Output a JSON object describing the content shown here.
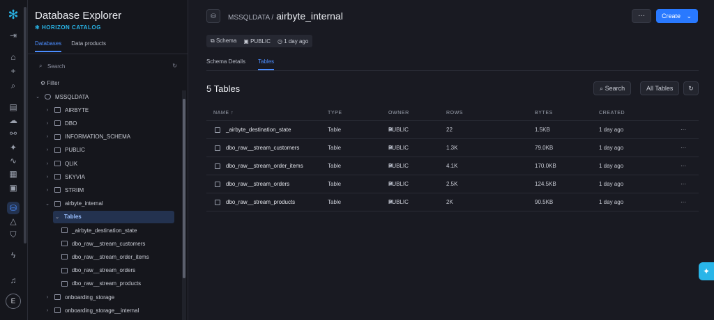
{
  "rail": {
    "logo_icon": "snowflake-icon",
    "collapse_icon": "collapse-icon",
    "avatar_initial": "E"
  },
  "sidebar": {
    "title": "Database Explorer",
    "subtitle": "HORIZON CATALOG",
    "tabs": [
      "Databases",
      "Data products"
    ],
    "search_placeholder": "Search",
    "filter_label": "Filter",
    "tree": [
      {
        "label": "MSSQLDATA",
        "level": 0,
        "expanded": true,
        "type": "database"
      },
      {
        "label": "AIRBYTE",
        "level": 1,
        "expanded": false,
        "type": "schema"
      },
      {
        "label": "DBO",
        "level": 1,
        "expanded": false,
        "type": "schema"
      },
      {
        "label": "INFORMATION_SCHEMA",
        "level": 1,
        "expanded": false,
        "type": "schema"
      },
      {
        "label": "PUBLIC",
        "level": 1,
        "expanded": false,
        "type": "schema"
      },
      {
        "label": "QLIK",
        "level": 1,
        "expanded": false,
        "type": "schema"
      },
      {
        "label": "SKYVIA",
        "level": 1,
        "expanded": false,
        "type": "schema"
      },
      {
        "label": "STRIIM",
        "level": 1,
        "expanded": false,
        "type": "schema"
      },
      {
        "label": "airbyte_internal",
        "level": 1,
        "expanded": true,
        "type": "schema"
      },
      {
        "label": "Tables",
        "level": 2,
        "expanded": true,
        "type": "folder",
        "selected": true
      },
      {
        "label": "_airbyte_destination_state",
        "level": 3,
        "type": "table"
      },
      {
        "label": "dbo_raw__stream_customers",
        "level": 3,
        "type": "table"
      },
      {
        "label": "dbo_raw__stream_order_items",
        "level": 3,
        "type": "table"
      },
      {
        "label": "dbo_raw__stream_orders",
        "level": 3,
        "type": "table"
      },
      {
        "label": "dbo_raw__stream_products",
        "level": 3,
        "type": "table"
      },
      {
        "label": "onboarding_storage",
        "level": 1,
        "expanded": false,
        "type": "schema"
      },
      {
        "label": "onboarding_storage__internal",
        "level": 1,
        "expanded": false,
        "type": "schema"
      }
    ]
  },
  "header": {
    "parent": "MSSQLDATA /",
    "title": "airbyte_internal",
    "more_label": "···",
    "create_label": "Create",
    "chips": [
      "Schema",
      "PUBLIC",
      "1 day ago"
    ]
  },
  "tabs": [
    "Schema Details",
    "Tables"
  ],
  "content": {
    "count_label": "5 Tables",
    "search_label": "Search",
    "filter_label": "All Tables",
    "columns": [
      "NAME ↑",
      "TYPE",
      "OWNER",
      "ROWS",
      "BYTES",
      "CREATED"
    ],
    "rows": [
      {
        "name": "_airbyte_destination_state",
        "type": "Table",
        "owner": "PUBLIC",
        "rows": "22",
        "bytes": "1.5KB",
        "created": "1 day ago"
      },
      {
        "name": "dbo_raw__stream_customers",
        "type": "Table",
        "owner": "PUBLIC",
        "rows": "1.3K",
        "bytes": "79.0KB",
        "created": "1 day ago"
      },
      {
        "name": "dbo_raw__stream_order_items",
        "type": "Table",
        "owner": "PUBLIC",
        "rows": "4.1K",
        "bytes": "170.0KB",
        "created": "1 day ago"
      },
      {
        "name": "dbo_raw__stream_orders",
        "type": "Table",
        "owner": "PUBLIC",
        "rows": "2.5K",
        "bytes": "124.5KB",
        "created": "1 day ago"
      },
      {
        "name": "dbo_raw__stream_products",
        "type": "Table",
        "owner": "PUBLIC",
        "rows": "2K",
        "bytes": "90.5KB",
        "created": "1 day ago"
      }
    ]
  },
  "colors": {
    "accent": "#2979ff",
    "brand": "#29b5e8",
    "background": "#191a22"
  }
}
